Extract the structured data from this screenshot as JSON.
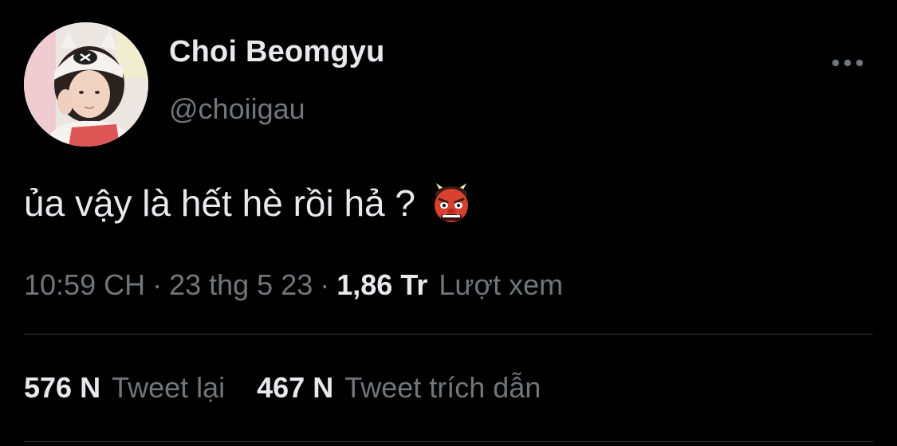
{
  "tweet": {
    "author": {
      "display_name": "Choi Beomgyu",
      "handle": "@choiigau",
      "avatar": "profile-photo"
    },
    "text": "ủa vậy là hết hè rồi hả ?",
    "emoji": "japanese-ogre-emoji",
    "meta": {
      "time": "10:59 CH",
      "separator": "·",
      "date": "23 thg 5 23",
      "views_count": "1,86 Tr",
      "views_label": "Lượt xem"
    },
    "stats": {
      "retweets": {
        "count": "576 N",
        "label": "Tweet lại"
      },
      "quotes": {
        "count": "467 N",
        "label": "Tweet trích dẫn"
      }
    },
    "more_icon": "more-horizontal-icon"
  },
  "colors": {
    "background": "#000000",
    "primary_text": "#e7e9ea",
    "secondary_text": "#71767b",
    "divider": "#2f3336"
  }
}
